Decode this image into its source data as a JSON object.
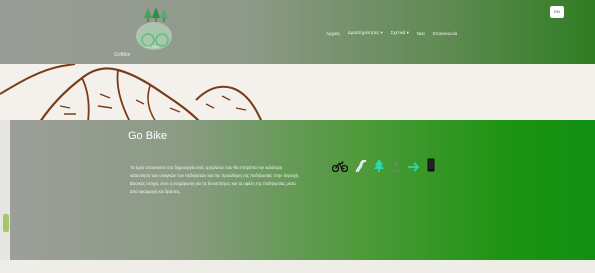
{
  "header": {
    "logo_text": "GoBike",
    "logo_sub": "Go Bike",
    "nav": [
      "Αρχική",
      "Δραστηριότητες ▾",
      "Σχετικά ▾",
      "Νέα",
      "Επικοινωνία"
    ],
    "lang": "EN"
  },
  "section": {
    "title": "Go Bike",
    "body": "Το έργο αποσκοπεί στη δημιουργία ενός εργαλείου που θα επιτρέπει την καλύτερη κατανόηση των αναγκών των ποδηλατών και την προώθηση της ποδηλασίας στην περιοχή. Βασικός στόχος είναι η ενημέρωση για τις δυνατότητες και τα οφέλη της ποδηλασίας μέσα από εφαρμογή και δράσεις.",
    "icons": [
      "bicycle-icon",
      "road-icon",
      "tree-icon",
      "person-icon",
      "arrow-right-icon",
      "phone-icon"
    ]
  },
  "colors": {
    "header_start": "#9a9c97",
    "header_end": "#2f7d23",
    "card_end": "#129012",
    "icon_teal": "#2dd8b0"
  }
}
